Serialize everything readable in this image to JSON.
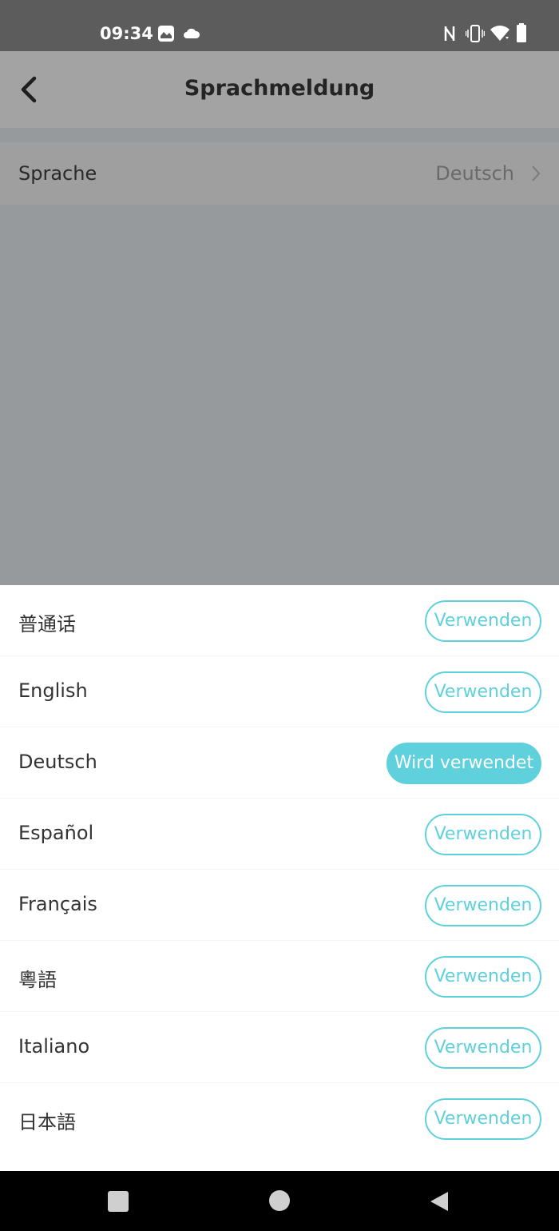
{
  "status_bar": {
    "time": "09:34",
    "icons": [
      "gallery-icon",
      "cloud-icon",
      "nfc-icon",
      "vibrate-icon",
      "wifi-icon",
      "battery-icon"
    ]
  },
  "app_bar": {
    "title": "Sprachmeldung",
    "back_icon": "chevron-left-icon"
  },
  "setting": {
    "label": "Sprache",
    "value": "Deutsch"
  },
  "languages": [
    {
      "name": "普通话",
      "action": "Verwenden",
      "state": "available"
    },
    {
      "name": "English",
      "action": "Verwenden",
      "state": "available"
    },
    {
      "name": "Deutsch",
      "action": "Wird verwendet",
      "state": "active"
    },
    {
      "name": "Español",
      "action": "Verwenden",
      "state": "available"
    },
    {
      "name": "Français",
      "action": "Verwenden",
      "state": "available"
    },
    {
      "name": "粵語",
      "action": "Verwenden",
      "state": "available"
    },
    {
      "name": "Italiano",
      "action": "Verwenden",
      "state": "available"
    },
    {
      "name": "日本語",
      "action": "Verwenden",
      "state": "available"
    }
  ],
  "nav_bar": {
    "icons": [
      "recent-apps-icon",
      "home-icon",
      "back-icon"
    ]
  },
  "colors": {
    "accent": "#5ed1dc",
    "scrim": "#979a9c"
  }
}
